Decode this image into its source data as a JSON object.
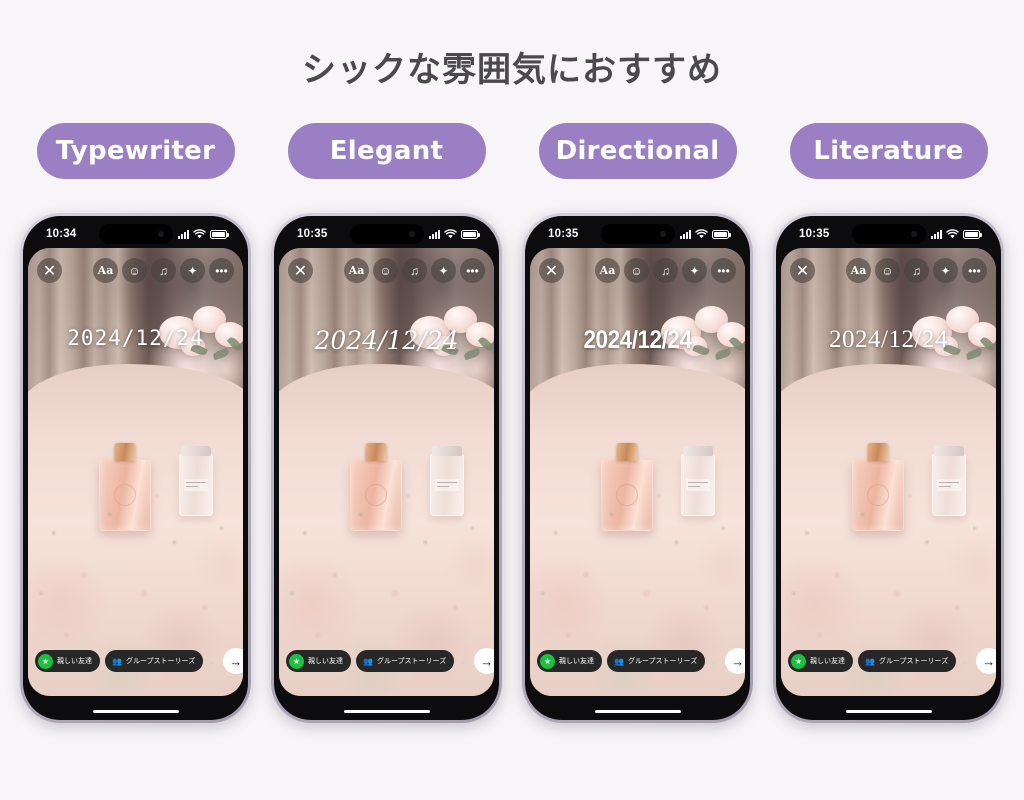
{
  "page": {
    "title": "シックな雰囲気におすすめ",
    "background_color": "#f7f5f8"
  },
  "style_pills": {
    "accent_color": "#9a7fc4",
    "text_color": "#ffffff",
    "items": [
      {
        "label": "Typewriter"
      },
      {
        "label": "Elegant"
      },
      {
        "label": "Directional"
      },
      {
        "label": "Literature"
      }
    ]
  },
  "toolbar_icons": {
    "close": "close-x-icon",
    "text": "Aa",
    "sticker": "☺",
    "music": "♫",
    "effects": "✦",
    "more": "•••"
  },
  "phones": [
    {
      "status": {
        "time": "10:34",
        "signal": "signal-bars-icon",
        "wifi": "wifi-icon",
        "battery": "battery-icon"
      },
      "date_overlay": "2024/12/24",
      "font_style": "Typewriter",
      "bottom_bar": {
        "close_friends_label": "親しい友達",
        "close_friends_icon": "green-star-icon",
        "group_stories_label": "グループストーリーズ",
        "group_stories_icon": "group-people-icon",
        "chevron": "⌄",
        "send_icon": "→"
      }
    },
    {
      "status": {
        "time": "10:35",
        "signal": "signal-bars-icon",
        "wifi": "wifi-icon",
        "battery": "battery-icon"
      },
      "date_overlay": "2024/12/24",
      "font_style": "Elegant",
      "bottom_bar": {
        "close_friends_label": "親しい友達",
        "close_friends_icon": "green-star-icon",
        "group_stories_label": "グループストーリーズ",
        "group_stories_icon": "group-people-icon",
        "chevron": "⌄",
        "send_icon": "→"
      }
    },
    {
      "status": {
        "time": "10:35",
        "signal": "signal-bars-icon",
        "wifi": "wifi-icon",
        "battery": "battery-icon"
      },
      "date_overlay": "2024/12/24",
      "font_style": "Directional",
      "bottom_bar": {
        "close_friends_label": "親しい友達",
        "close_friends_icon": "green-star-icon",
        "group_stories_label": "グループストーリーズ",
        "group_stories_icon": "group-people-icon",
        "chevron": "⌄",
        "send_icon": "→"
      }
    },
    {
      "status": {
        "time": "10:35",
        "signal": "signal-bars-icon",
        "wifi": "wifi-icon",
        "battery": "battery-icon"
      },
      "date_overlay": "2024/12/24",
      "font_style": "Literature",
      "bottom_bar": {
        "close_friends_label": "親しい友達",
        "close_friends_icon": "green-star-icon",
        "group_stories_label": "グループストーリーズ",
        "group_stories_icon": "group-people-icon",
        "chevron": "⌄",
        "send_icon": "→"
      }
    }
  ]
}
